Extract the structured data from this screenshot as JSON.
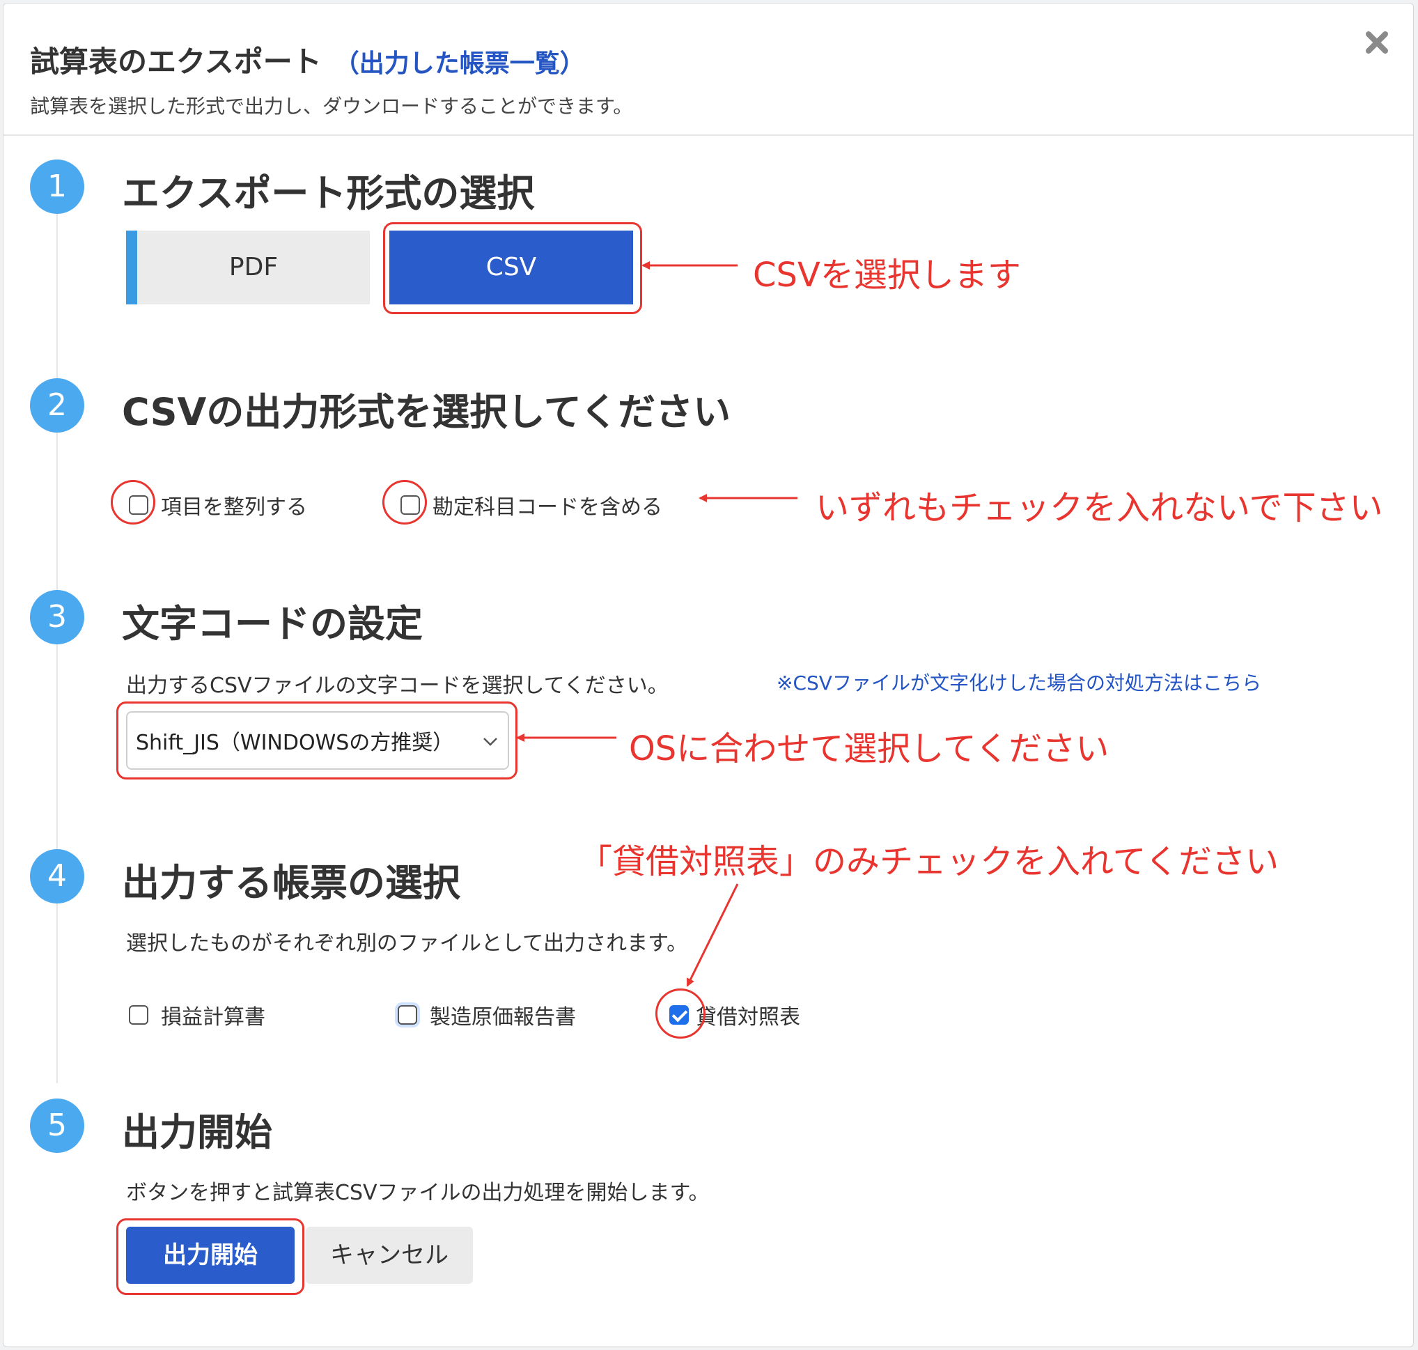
{
  "header": {
    "title": "試算表のエクスポート",
    "title_link": "（出力した帳票一覧）",
    "subtitle": "試算表を選択した形式で出力し、ダウンロードすることができます。"
  },
  "steps": [
    {
      "num": "1",
      "title": "エクスポート形式の選択"
    },
    {
      "num": "2",
      "title": "CSVの出力形式を選択してください"
    },
    {
      "num": "3",
      "title": "文字コードの設定"
    },
    {
      "num": "4",
      "title": "出力する帳票の選択"
    },
    {
      "num": "5",
      "title": "出力開始"
    }
  ],
  "format": {
    "options": [
      "PDF",
      "CSV"
    ],
    "selected": "CSV"
  },
  "csv_options": [
    {
      "label": "項目を整列する",
      "checked": false
    },
    {
      "label": "勘定科目コードを含める",
      "checked": false
    }
  ],
  "encoding": {
    "description": "出力するCSVファイルの文字コードを選択してください。",
    "help_link": "※CSVファイルが文字化けした場合の対処方法はこちら",
    "selected": "Shift_JIS（WINDOWSの方推奨）"
  },
  "reports": {
    "description": "選択したものがそれぞれ別のファイルとして出力されます。",
    "items": [
      {
        "label": "損益計算書",
        "checked": false
      },
      {
        "label": "製造原価報告書",
        "checked": false
      },
      {
        "label": "貸借対照表",
        "checked": true
      }
    ]
  },
  "start": {
    "description": "ボタンを押すと試算表CSVファイルの出力処理を開始します。",
    "start_label": "出力開始",
    "cancel_label": "キャンセル"
  },
  "annotations": {
    "csv_select": "CSVを選択します",
    "no_check": "いずれもチェックを入れないで下さい",
    "os_select": "OSに合わせて選択してください",
    "bs_only": "「貸借対照表」のみチェックを入れてください"
  },
  "colors": {
    "primary": "#2a5dcb",
    "step_circle": "#4aa9ef",
    "annotation_red": "#e8352f",
    "link": "#2455c3"
  }
}
